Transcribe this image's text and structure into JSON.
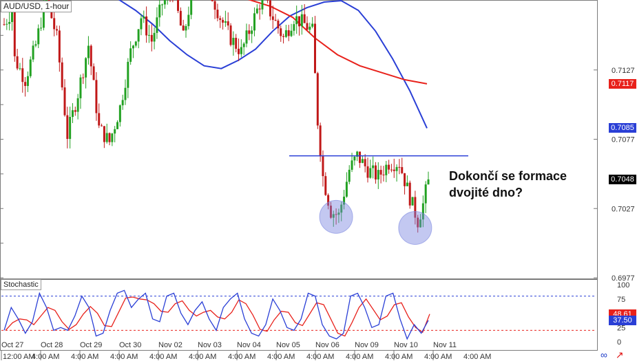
{
  "header": {
    "title": "AUD/USD, 1-hour"
  },
  "indicator": {
    "label": "Stochastic"
  },
  "annotation": {
    "text": "Dokončí se formace\ndvojité dno?"
  },
  "price_tags": [
    {
      "value": "0.7117",
      "bg": "#e8211b",
      "fg": "#ffffff"
    },
    {
      "value": "0.7085",
      "bg": "#2a3fd6",
      "fg": "#ffffff"
    },
    {
      "value": "0.7048",
      "bg": "#000000",
      "fg": "#ffffff"
    }
  ],
  "stoch_tags": [
    {
      "value": "48.61",
      "bg": "#e8211b",
      "fg": "#ffffff"
    },
    {
      "value": "37.50",
      "bg": "#2a3fd6",
      "fg": "#ffffff"
    }
  ],
  "colors": {
    "bull": "#22a122",
    "bear": "#c01818",
    "ma_fast": "#2a3fd6",
    "ma_slow": "#e8211b",
    "neckline": "#2a3fd6",
    "circle": "#7a86e0",
    "stoch_k": "#2a3fd6",
    "stoch_d": "#e8211b",
    "stoch_level_hi": "#2a3fd6",
    "stoch_level_lo": "#e8211b"
  },
  "icons": [
    "link-icon",
    "arrow-icon"
  ],
  "chart_data": {
    "type": "candlestick",
    "title": "AUD/USD, 1-hour",
    "y_ticks": [
      "0.7127",
      "0.7077",
      "0.7027",
      "0.6977"
    ],
    "y_tick_values": [
      0.7127,
      0.7077,
      0.7027,
      0.6977
    ],
    "ylim": [
      0.6977,
      0.7177
    ],
    "x_date_labels": [
      "Oct 27",
      "Oct 28",
      "Oct 29",
      "Oct 30",
      "Nov 02",
      "Nov 03",
      "Nov 04",
      "Nov 05",
      "Nov 06",
      "Nov 09",
      "Nov 10",
      "Nov 11"
    ],
    "x_time_labels": [
      "4:00 AM",
      "4:00 AM",
      "4:00 AM",
      "4:00 AM",
      "4:00 AM",
      "4:00 AM",
      "4:00 AM",
      "4:00 AM",
      "4:00 AM",
      "4:00 AM",
      "4:00 AM",
      "4:00 AM"
    ],
    "x_first_label": "12:00 AM",
    "neckline": 0.7065,
    "last_price": 0.7048,
    "ma_fast_last": 0.7085,
    "ma_slow_last": 0.7117,
    "ma_fast_path": [
      0.7178,
      0.717,
      0.716,
      0.7148,
      0.7138,
      0.713,
      0.7128,
      0.7134,
      0.7142,
      0.7155,
      0.7166,
      0.7172,
      0.7176,
      0.7177,
      0.717,
      0.7155,
      0.7135,
      0.7112,
      0.7085
    ],
    "ma_slow_path": [
      0.7178,
      0.7173,
      0.7165,
      0.715,
      0.7138,
      0.713,
      0.7125,
      0.712,
      0.7117
    ],
    "bottoms": [
      0.702,
      0.7012
    ],
    "swing_points": [
      [
        0,
        0.716
      ],
      [
        3,
        0.717
      ],
      [
        4,
        0.7135
      ],
      [
        8,
        0.712
      ],
      [
        12,
        0.7145
      ],
      [
        16,
        0.718
      ],
      [
        20,
        0.715
      ],
      [
        24,
        0.708
      ],
      [
        28,
        0.711
      ],
      [
        32,
        0.7145
      ],
      [
        36,
        0.7085
      ],
      [
        40,
        0.7075
      ],
      [
        44,
        0.71
      ],
      [
        48,
        0.714
      ],
      [
        52,
        0.7165
      ],
      [
        56,
        0.7148
      ],
      [
        60,
        0.7175
      ],
      [
        64,
        0.7185
      ],
      [
        68,
        0.715
      ],
      [
        72,
        0.719
      ],
      [
        78,
        0.7185
      ],
      [
        82,
        0.7165
      ],
      [
        86,
        0.715
      ],
      [
        90,
        0.714
      ],
      [
        94,
        0.716
      ],
      [
        98,
        0.718
      ],
      [
        102,
        0.7165
      ],
      [
        106,
        0.715
      ],
      [
        110,
        0.7165
      ],
      [
        114,
        0.716
      ],
      [
        117,
        0.7155
      ],
      [
        119,
        0.709
      ],
      [
        121,
        0.705
      ],
      [
        124,
        0.7025
      ],
      [
        127,
        0.7022
      ],
      [
        131,
        0.7055
      ],
      [
        134,
        0.7065
      ],
      [
        138,
        0.7055
      ],
      [
        142,
        0.705
      ],
      [
        146,
        0.706
      ],
      [
        150,
        0.706
      ],
      [
        154,
        0.7035
      ],
      [
        157,
        0.7018
      ],
      [
        159,
        0.703
      ],
      [
        161,
        0.7048
      ]
    ],
    "stochastic": {
      "levels": [
        80,
        20
      ],
      "y_ticks": [
        "100",
        "75",
        "50",
        "25",
        "0"
      ],
      "ylim": [
        0,
        100
      ],
      "k_last": 37.5,
      "d_last": 48.61,
      "k_path": [
        20,
        60,
        40,
        15,
        35,
        85,
        60,
        20,
        25,
        20,
        45,
        80,
        60,
        10,
        15,
        55,
        85,
        90,
        60,
        75,
        85,
        40,
        35,
        80,
        85,
        50,
        30,
        55,
        70,
        40,
        20,
        60,
        75,
        85,
        40,
        15,
        10,
        30,
        75,
        55,
        25,
        20,
        40,
        85,
        80,
        30,
        10,
        5,
        15,
        80,
        85,
        60,
        25,
        30,
        80,
        85,
        40,
        5,
        30,
        15,
        45
      ]
    }
  }
}
